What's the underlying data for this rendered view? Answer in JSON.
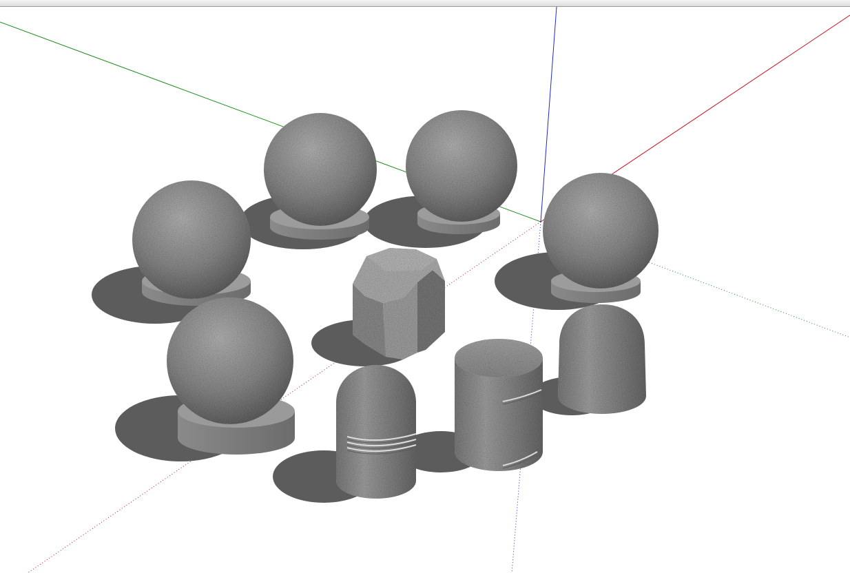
{
  "window": {
    "title": ""
  },
  "scene": {
    "background": "#ffffff",
    "axis_colors": {
      "red": "#c8141e",
      "green": "#1e8c1e",
      "blue": "#1e28c8"
    },
    "stone_color": "#8c8c8c",
    "shadow_color": "#5c5c5c",
    "objects": [
      "granite-sphere-bollard",
      "granite-sphere-bollard",
      "granite-sphere-bollard",
      "granite-sphere-bollard",
      "granite-sphere-bollard",
      "granite-octagonal-bollard",
      "granite-capsule-bollard",
      "granite-cylinder-bollard",
      "granite-dome-bollard"
    ]
  }
}
